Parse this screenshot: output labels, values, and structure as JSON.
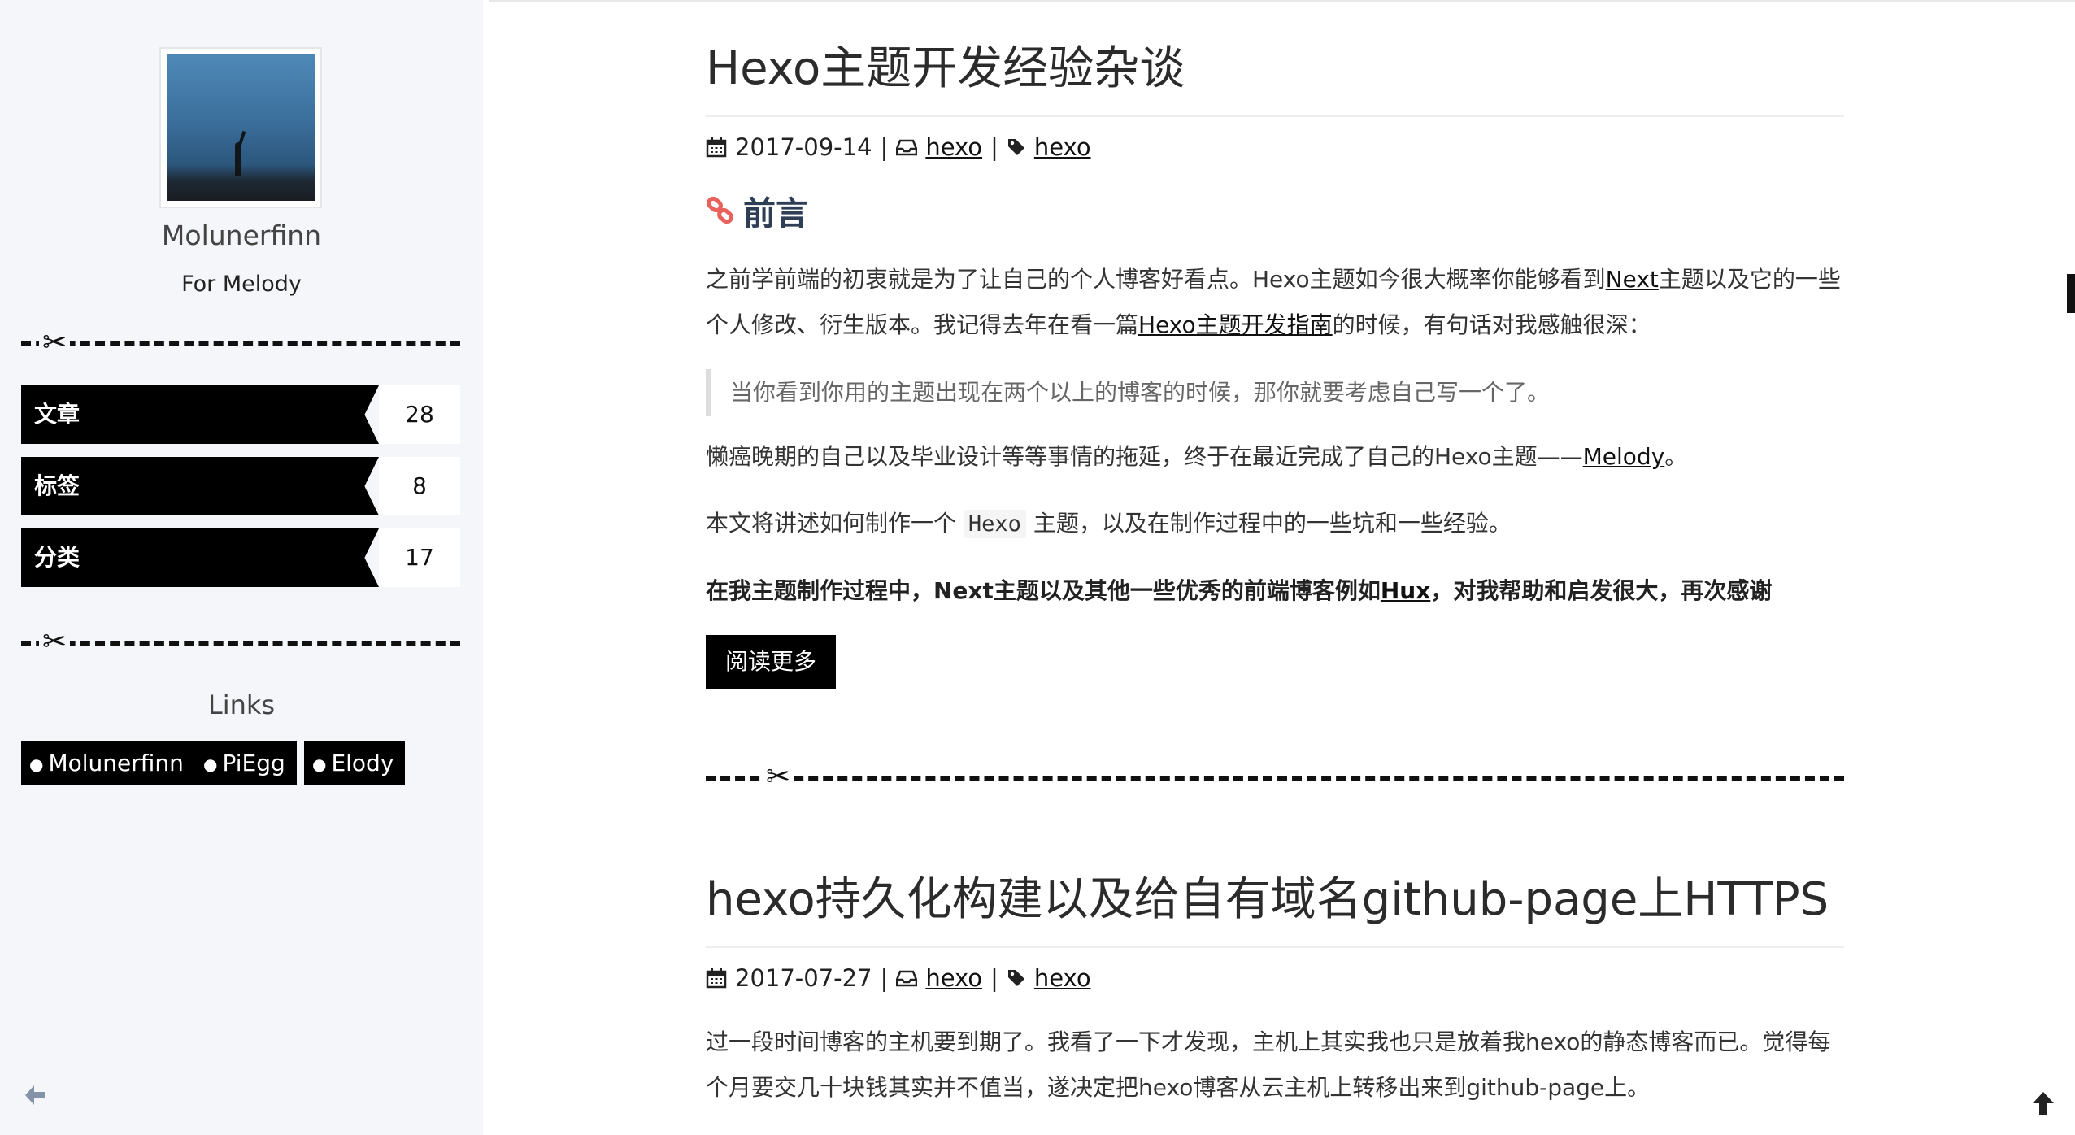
{
  "sidebar": {
    "author": "Molunerfinn",
    "subtitle": "For Melody",
    "stats": [
      {
        "label": "文章",
        "count": "28"
      },
      {
        "label": "标签",
        "count": "8"
      },
      {
        "label": "分类",
        "count": "17"
      }
    ],
    "links_title": "Links",
    "links": [
      "Molunerfinn",
      "PiEgg",
      "Elody"
    ]
  },
  "posts": [
    {
      "title": "Hexo主题开发经验杂谈",
      "date": "2017-09-14",
      "category": "hexo",
      "tag": "hexo",
      "section_heading": "前言",
      "p1_a": "之前学前端的初衷就是为了让自己的个人博客好看点。Hexo主题如今很大概率你能够看到",
      "p1_link1": "Next",
      "p1_b": "主题以及它的一些个人修改、衍生版本。我记得去年在看一篇",
      "p1_link2": "Hexo主题开发指南",
      "p1_c": "的时候，有句话对我感触很深：",
      "quote": "当你看到你用的主题出现在两个以上的博客的时候，那你就要考虑自己写一个了。",
      "p2_a": "懒癌晚期的自己以及毕业设计等等事情的拖延，终于在最近完成了自己的Hexo主题——",
      "p2_link": "Melody",
      "p2_b": "。",
      "p3_a": "本文将讲述如何制作一个 ",
      "p3_code": "Hexo",
      "p3_b": " 主题，以及在制作过程中的一些坑和一些经验。",
      "p4_a": "在我主题制作过程中，Next主题以及其他一些优秀的前端博客例如",
      "p4_link": "Hux",
      "p4_b": "，对我帮助和启发很大，再次感谢",
      "read_more": "阅读更多"
    },
    {
      "title": "hexo持久化构建以及给自有域名github-page上HTTPS",
      "date": "2017-07-27",
      "category": "hexo",
      "tag": "hexo",
      "p1": "过一段时间博客的主机要到期了。我看了一下才发现，主机上其实我也只是放着我hexo的静态博客而已。觉得每个月要交几十块钱其实并不值当，遂决定把hexo博客从云主机上转移出来到github-page上。"
    }
  ],
  "icons": {
    "calendar": "calendar-icon",
    "category": "inbox-icon",
    "tag": "tag-icon",
    "section": "link-icon",
    "scissors": "scissors-icon",
    "back": "arrow-left-icon",
    "top": "arrow-up-icon"
  },
  "colors": {
    "sidebar_bg": "#f5f6f9",
    "accent": "#000000",
    "section_icon": "#e8615a",
    "heading": "#2e3e55"
  }
}
